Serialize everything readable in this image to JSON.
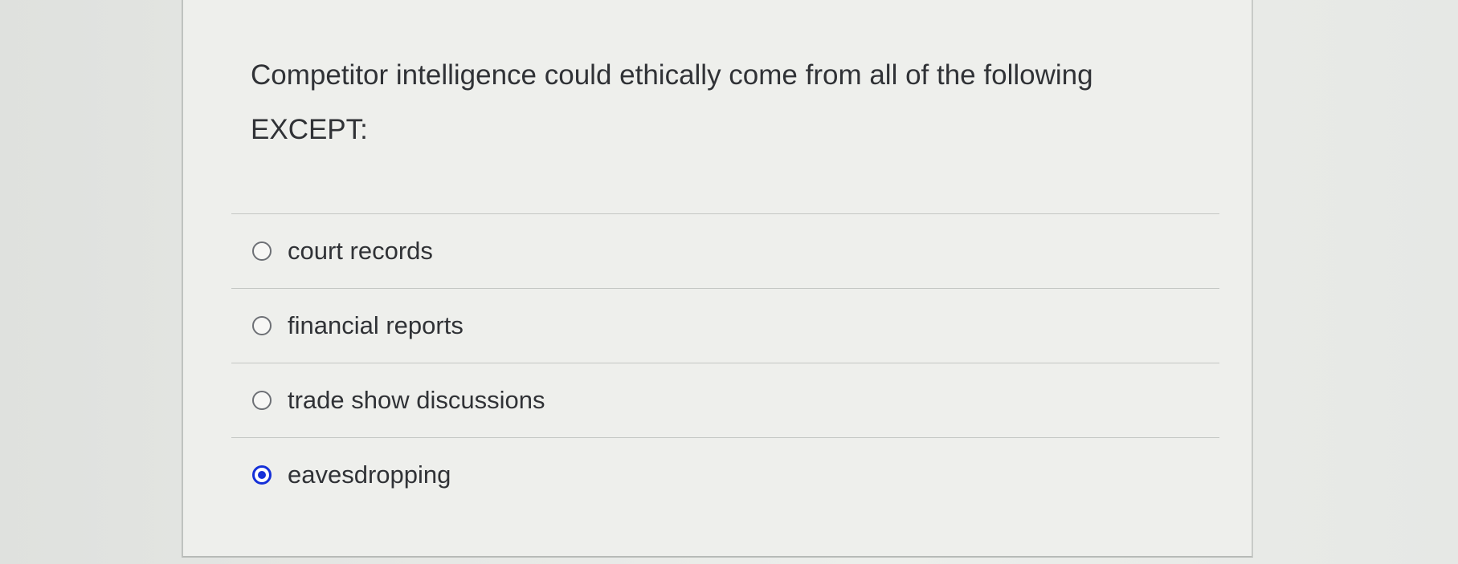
{
  "question": {
    "prompt": "Competitor intelligence could ethically come from all of the following EXCEPT:"
  },
  "answers": [
    {
      "label": "court records",
      "selected": false
    },
    {
      "label": "financial reports",
      "selected": false
    },
    {
      "label": "trade show discussions",
      "selected": false
    },
    {
      "label": "eavesdropping",
      "selected": true
    }
  ],
  "colors": {
    "selected_radio": "#1530d8",
    "text": "#303236",
    "divider": "#c4c7c4"
  }
}
